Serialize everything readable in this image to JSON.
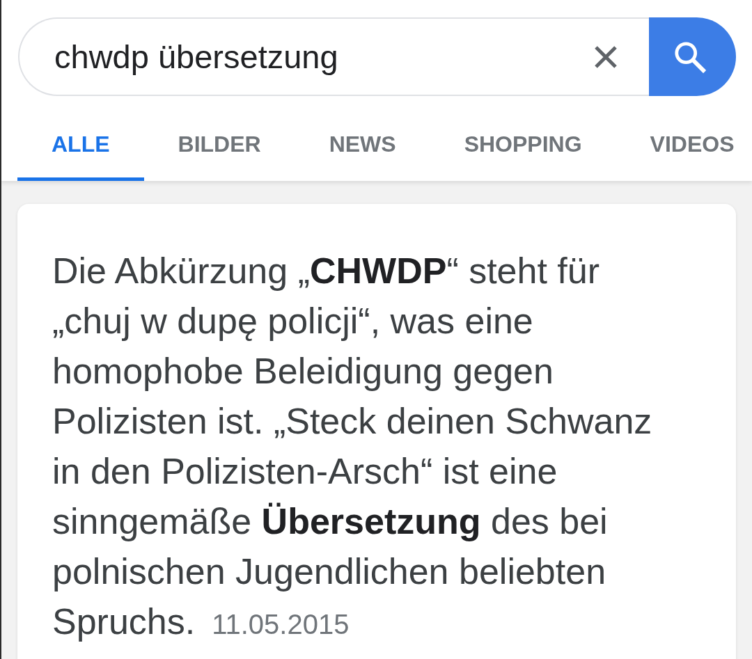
{
  "search": {
    "query": "chwdp übersetzung"
  },
  "tabs": [
    {
      "label": "ALLE",
      "selected": true
    },
    {
      "label": "BILDER",
      "selected": false
    },
    {
      "label": "NEWS",
      "selected": false
    },
    {
      "label": "SHOPPING",
      "selected": false
    },
    {
      "label": "VIDEOS",
      "selected": false
    }
  ],
  "result": {
    "snippet": "Die Abkürzung „**CHWDP**“ steht für „chuj w dupę policji“, was eine homophobe Beleidigung gegen Polizisten ist. „Steck deinen Schwanz in den Polizisten-Arsch“ ist eine sinngemäße **Übersetzung** des bei polnischen Jugendlichen beliebten Spruchs.",
    "date": "11.05.2015"
  }
}
